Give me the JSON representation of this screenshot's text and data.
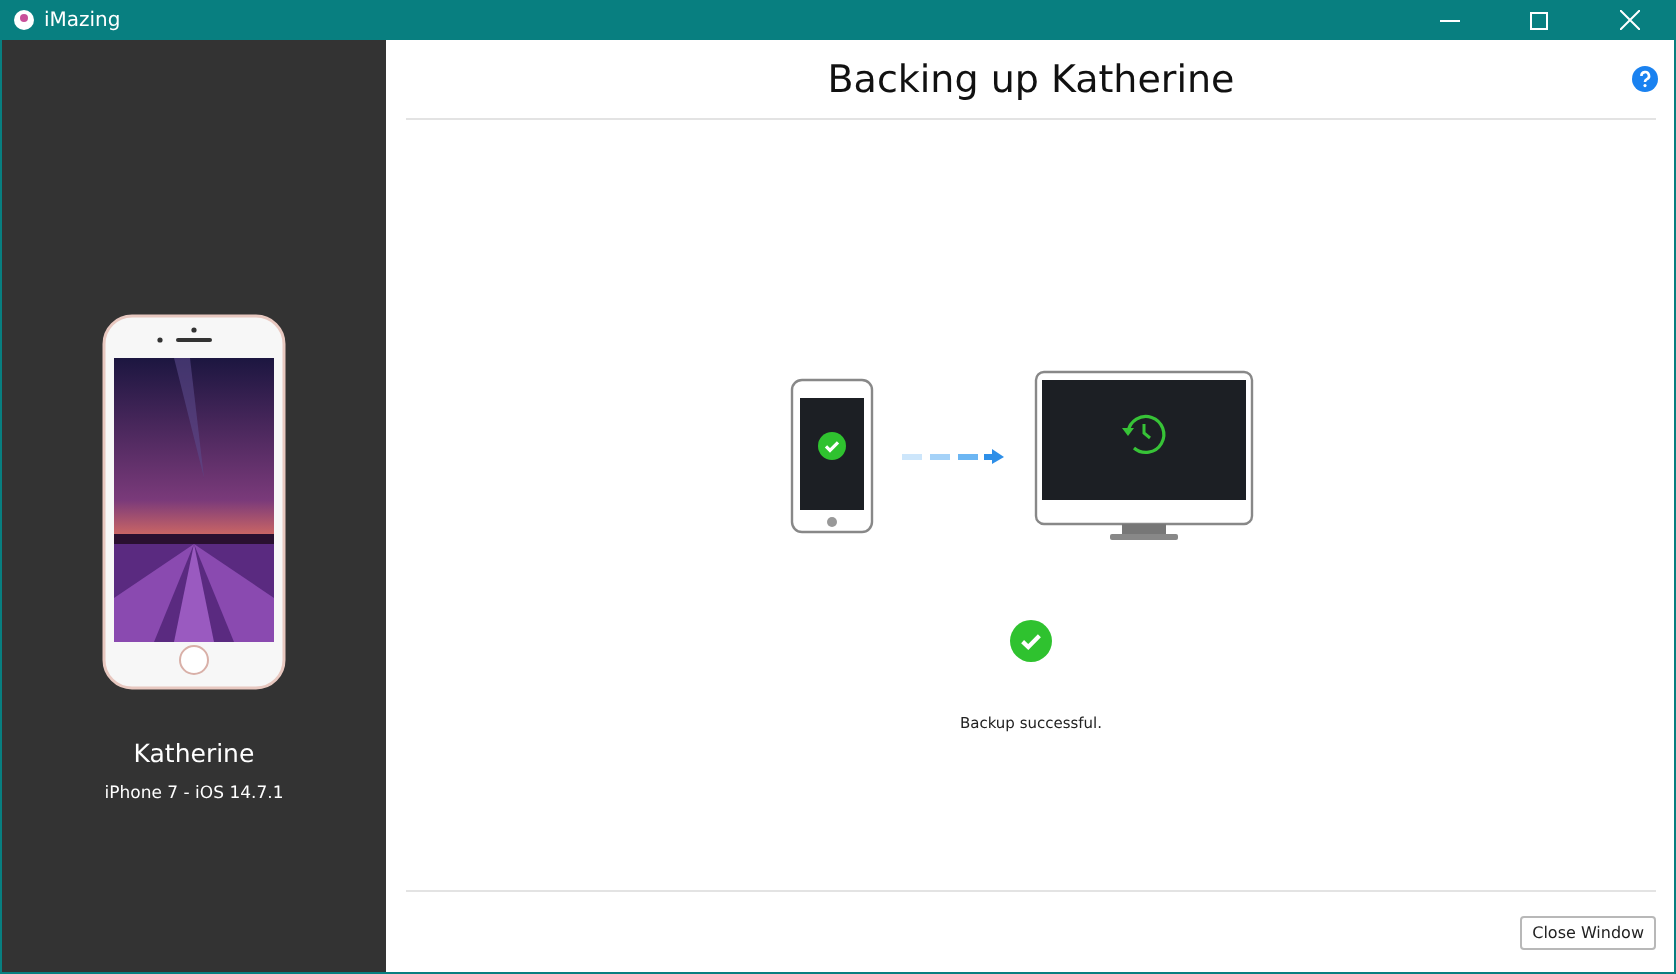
{
  "window": {
    "title": "iMazing"
  },
  "device": {
    "name": "Katherine",
    "model": "iPhone 7 - iOS 14.7.1"
  },
  "header": {
    "title": "Backing up Katherine"
  },
  "status": {
    "message": "Backup successful."
  },
  "footer": {
    "button": "Close Window"
  }
}
